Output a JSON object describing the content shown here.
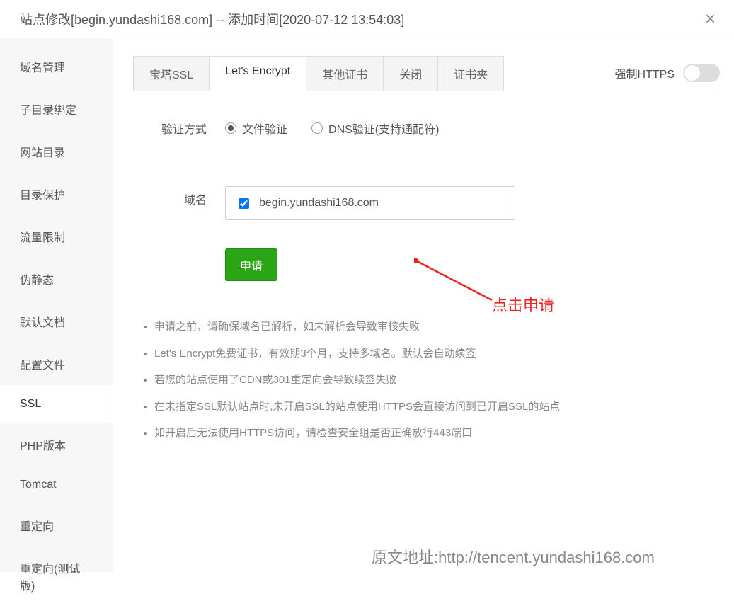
{
  "header": {
    "title": "站点修改[begin.yundashi168.com] -- 添加时间[2020-07-12 13:54:03]"
  },
  "sidebar": {
    "items": [
      {
        "label": "域名管理",
        "key": "domain-mgmt"
      },
      {
        "label": "子目录绑定",
        "key": "subdir-bind"
      },
      {
        "label": "网站目录",
        "key": "site-dir"
      },
      {
        "label": "目录保护",
        "key": "dir-protect"
      },
      {
        "label": "流量限制",
        "key": "traffic-limit"
      },
      {
        "label": "伪静态",
        "key": "pseudo-static"
      },
      {
        "label": "默认文档",
        "key": "default-doc"
      },
      {
        "label": "配置文件",
        "key": "config-file"
      },
      {
        "label": "SSL",
        "key": "ssl",
        "active": true
      },
      {
        "label": "PHP版本",
        "key": "php-ver"
      },
      {
        "label": "Tomcat",
        "key": "tomcat"
      },
      {
        "label": "重定向",
        "key": "redirect"
      },
      {
        "label": "重定向(测试版)",
        "key": "redirect-beta"
      }
    ]
  },
  "tabs": [
    {
      "label": "宝塔SSL",
      "key": "bt-ssl"
    },
    {
      "label": "Let's Encrypt",
      "key": "lets-encrypt",
      "active": true
    },
    {
      "label": "其他证书",
      "key": "other-cert"
    },
    {
      "label": "关闭",
      "key": "close"
    },
    {
      "label": "证书夹",
      "key": "cert-folder"
    }
  ],
  "forceHttps": {
    "label": "强制HTTPS",
    "on": false
  },
  "form": {
    "verifyLabel": "验证方式",
    "radioFile": "文件验证",
    "radioDns": "DNS验证(支持通配符)",
    "domainLabel": "域名",
    "domainValue": "begin.yundashi168.com",
    "applyLabel": "申请"
  },
  "annotation": "点击申请",
  "notes": [
    "申请之前，请确保域名已解析，如未解析会导致审核失败",
    "Let's Encrypt免费证书，有效期3个月，支持多域名。默认会自动续签",
    "若您的站点使用了CDN或301重定向会导致续签失败",
    "在未指定SSL默认站点时,未开启SSL的站点使用HTTPS会直接访问到已开启SSL的站点",
    "如开启后无法使用HTTPS访问，请检查安全组是否正确放行443端口"
  ],
  "footer": "原文地址:http://tencent.yundashi168.com"
}
